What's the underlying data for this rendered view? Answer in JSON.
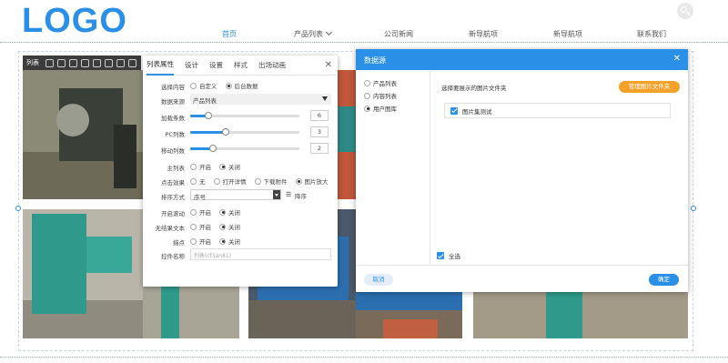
{
  "header": {
    "logo": "LOGO",
    "nav": [
      {
        "label": "首页",
        "active": true
      },
      {
        "label": "产品列表",
        "active": false,
        "has_dropdown": true
      },
      {
        "label": "公司新闻",
        "active": false
      },
      {
        "label": "新导航项",
        "active": false
      },
      {
        "label": "新导航项",
        "active": false
      },
      {
        "label": "联系我们",
        "active": false
      }
    ]
  },
  "toolbar": {
    "label": "列表"
  },
  "props_panel": {
    "tabs": [
      "列表属性",
      "设计",
      "设置",
      "样式",
      "出场动画"
    ],
    "active_tab": "列表属性",
    "close": "✕",
    "select_content": {
      "label": "选择内容",
      "options": [
        "自定义",
        "后台数据"
      ],
      "selected": "后台数据"
    },
    "data_source": {
      "label": "数据来源",
      "value": "产品列表"
    },
    "load_cols": {
      "label": "加载条数",
      "value": "6"
    },
    "pc_cols": {
      "label": "PC列数",
      "value": "3"
    },
    "mobile_cols": {
      "label": "移动列数",
      "value": "2"
    },
    "main_list": {
      "label": "主列表",
      "options": [
        "开启",
        "关闭"
      ],
      "selected": "关闭"
    },
    "click_effect": {
      "label": "点击效果",
      "options": [
        "无",
        "打开详情",
        "下载附件",
        "图片放大"
      ],
      "selected": "图片放大"
    },
    "sort": {
      "label": "排序方式",
      "value": "序号",
      "order": "降序"
    },
    "scroll": {
      "label": "开启滚动",
      "options": [
        "开启",
        "关闭"
      ],
      "selected": "关闭"
    },
    "no_result": {
      "label": "无结果文本",
      "options": [
        "开启",
        "关闭"
      ],
      "selected": "关闭"
    },
    "dots": {
      "label": "描点",
      "options": [
        "开启",
        "关闭"
      ],
      "selected": "关闭"
    },
    "control_name": {
      "label": "控件名称",
      "placeholder": "列表(cf3an81)"
    }
  },
  "dialog": {
    "title": "数据源",
    "close": "✕",
    "sources": [
      {
        "label": "产品列表",
        "selected": false
      },
      {
        "label": "内容列表",
        "selected": false
      },
      {
        "label": "用户图库",
        "selected": true
      }
    ],
    "prompt": "选择要展示的图片文件夹",
    "manage_button": "管理图片文件夹",
    "folders": [
      {
        "label": "图片集测试",
        "checked": true
      }
    ],
    "select_all": "全选",
    "cancel": "取消",
    "confirm": "确定"
  },
  "colors": {
    "accent": "#2a8fe6",
    "orange": "#f5a12a",
    "dark_toolbar": "#3c3c3c"
  }
}
